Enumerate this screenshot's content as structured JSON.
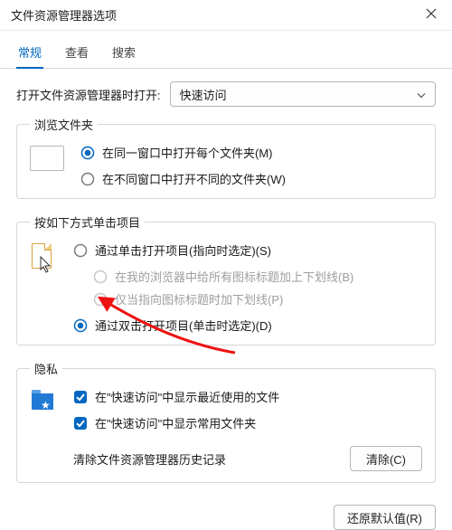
{
  "window": {
    "title": "文件资源管理器选项"
  },
  "tabs": {
    "general": "常规",
    "view": "查看",
    "search": "搜索"
  },
  "open_to": {
    "label": "打开文件资源管理器时打开:",
    "value": "快速访问"
  },
  "browse_folders": {
    "legend": "浏览文件夹",
    "same_window": "在同一窗口中打开每个文件夹(M)",
    "new_window": "在不同窗口中打开不同的文件夹(W)"
  },
  "click_items": {
    "legend": "按如下方式单击项目",
    "single": "通过单击打开项目(指向时选定)(S)",
    "underline_browser": "在我的浏览器中给所有图标标题加上下划线(B)",
    "underline_point": "仅当指向图标标题时加下划线(P)",
    "double": "通过双击打开项目(单击时选定)(D)"
  },
  "privacy": {
    "legend": "隐私",
    "recent_files": "在\"快速访问\"中显示最近使用的文件",
    "frequent_folders": "在\"快速访问\"中显示常用文件夹",
    "clear_label": "清除文件资源管理器历史记录",
    "clear_btn": "清除(C)"
  },
  "footer": {
    "restore": "还原默认值(R)"
  }
}
